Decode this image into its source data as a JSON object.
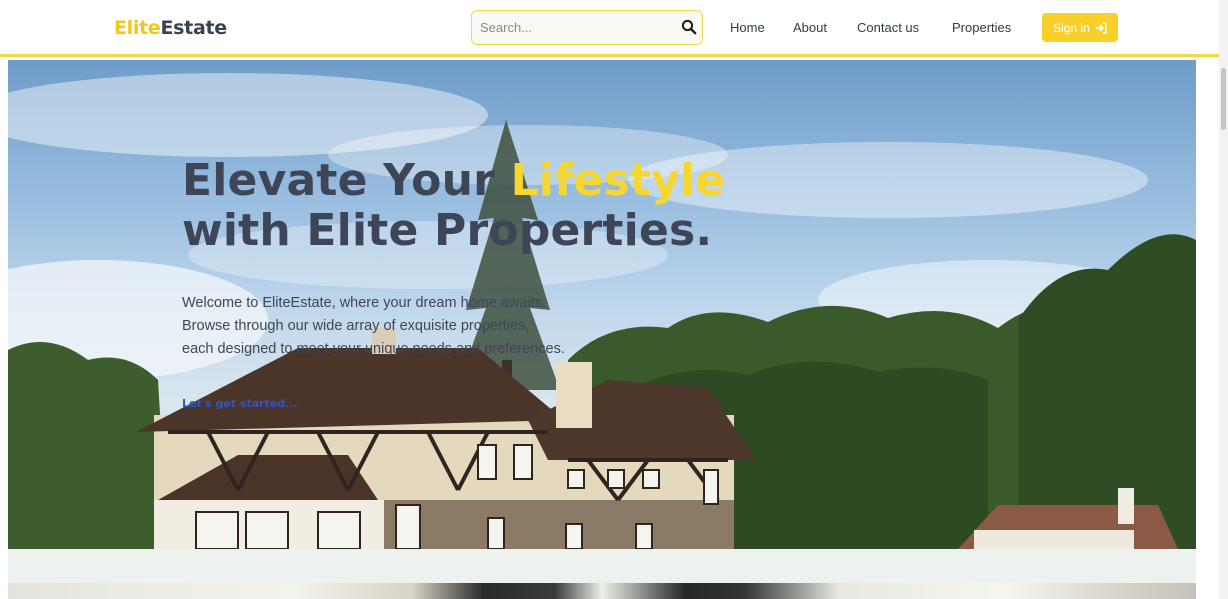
{
  "header": {
    "logo_part1": "Elite",
    "logo_part2": "Estate",
    "search_placeholder": "Search...",
    "search_icon": "search-icon",
    "nav": [
      "Home",
      "About",
      "Contact us",
      "Properties"
    ],
    "signin_label": "Sign in",
    "signin_icon": "sign-in-icon"
  },
  "hero": {
    "title_part1": "Elevate Your",
    "title_highlight": "Lifestyle",
    "title_part2": "with Elite Properties.",
    "description_lines": [
      "Welcome to EliteEstate, where your dream home awaits.",
      "Browse through our wide array of exquisite properties,",
      "each designed to meet your unique needs and preferences."
    ],
    "cta": "Let's get started..."
  },
  "colors": {
    "accent": "#f5c518",
    "header_border": "#f2d94a",
    "title": "#3e4556",
    "cta": "#2e55c9"
  }
}
